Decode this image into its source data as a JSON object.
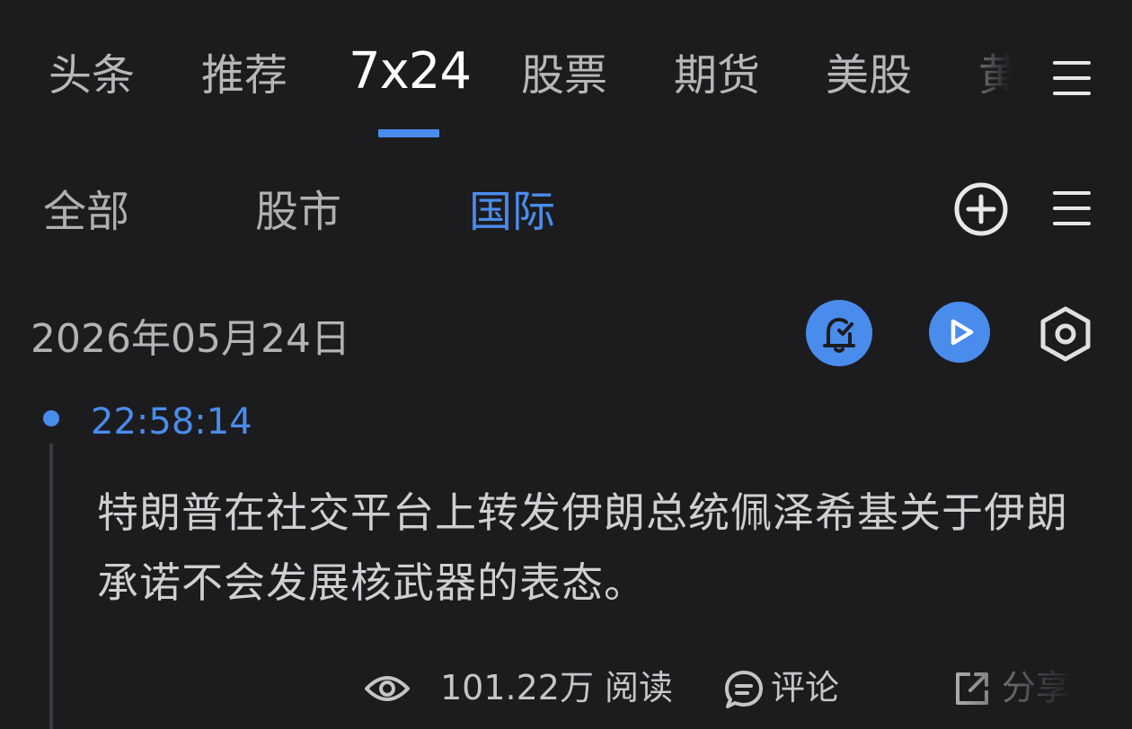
{
  "top_tabs": [
    {
      "label": "头条"
    },
    {
      "label": "推荐"
    },
    {
      "label": "7x24",
      "active": true
    },
    {
      "label": "股票"
    },
    {
      "label": "期货"
    },
    {
      "label": "美股"
    },
    {
      "label": "黄"
    }
  ],
  "sub_tabs": [
    {
      "label": "全部"
    },
    {
      "label": "股市"
    },
    {
      "label": "国际",
      "active": true
    }
  ],
  "date_header": "2026年05月24日",
  "news_item": {
    "time": "22:58:14",
    "text": "特朗普在社交平台上转发伊朗总统佩泽希基关于伊朗承诺不会发展核武器的表态。",
    "views": "101.22万 阅读",
    "comment_label": "评论",
    "share_label": "分享"
  },
  "colors": {
    "background": "#1c1c1f",
    "accent": "#4a8cec",
    "text_primary": "#ffffff",
    "text_secondary": "#b7b7ba"
  },
  "icons": [
    "menu-icon",
    "add-circle-icon",
    "alarm-check-icon",
    "play-icon",
    "settings-hexagon-icon",
    "eye-icon",
    "comment-icon",
    "share-icon"
  ]
}
